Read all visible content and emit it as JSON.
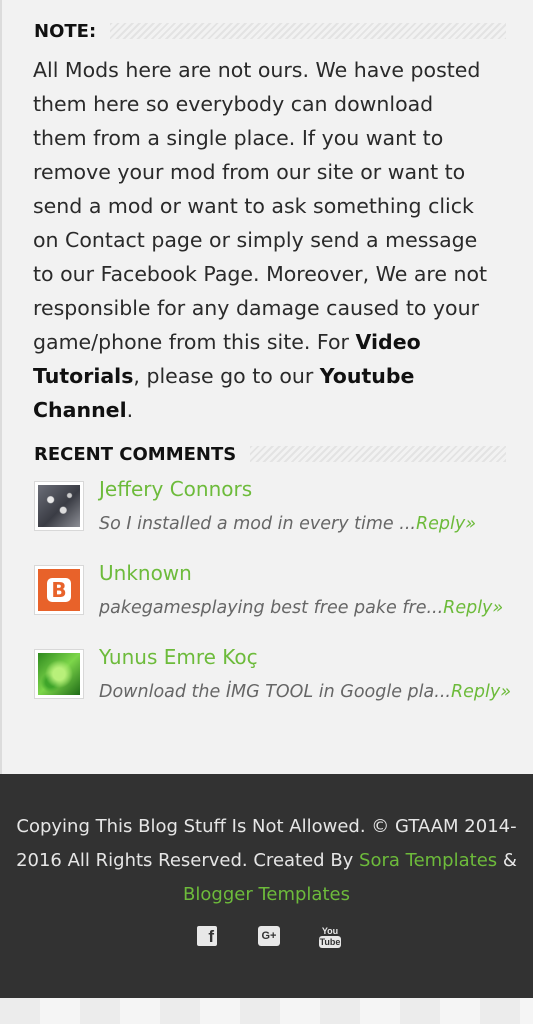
{
  "note": {
    "title": "NOTE:",
    "text_before": "All Mods here are not ours. We have posted them here so everybody can download them from a single place. If you want to remove your mod from our site or want to send a mod or want to ask something click on Contact page or simply send a message to our Facebook Page. Moreover, We are not responsible for any damage caused to your game/phone from this site. For ",
    "bold_video": "Video Tutorials",
    "text_middle": ", please go to our ",
    "bold_youtube": "Youtube Channel",
    "text_end": "."
  },
  "recent_comments": {
    "title": "RECENT COMMENTS",
    "items": [
      {
        "name": "Jeffery Connors",
        "snippet": "So I installed a mod in every time ...",
        "reply": "Reply»"
      },
      {
        "name": "Unknown",
        "snippet": "pakegamesplaying best free pake fre...",
        "reply": "Reply»"
      },
      {
        "name": "Yunus Emre Koç",
        "snippet": "Download the İMG TOOL in Google pla...",
        "reply": "Reply»"
      }
    ]
  },
  "footer": {
    "copyright": "Copying This Blog Stuff Is Not Allowed. © GTAAM 2014-2016 All Rights Reserved. Created By ",
    "link1": "Sora Templates",
    "amp": " & ",
    "link2": "Blogger Templates",
    "social": {
      "facebook": "f",
      "google_plus": "G+",
      "youtube_top": "You",
      "youtube_bottom": "Tube"
    }
  },
  "colors": {
    "accent": "#6dbb3b",
    "footer_bg": "#323232",
    "page_bg": "#f2f2f2"
  }
}
